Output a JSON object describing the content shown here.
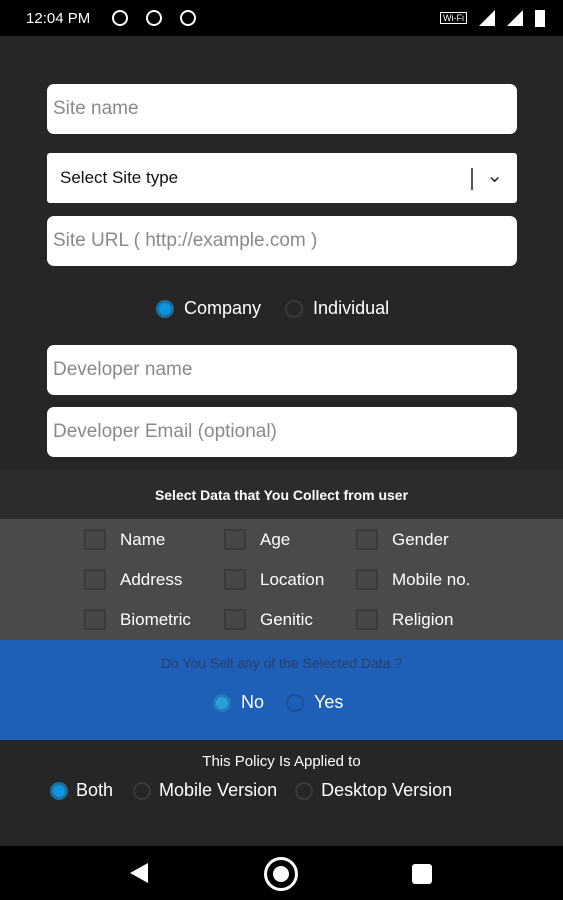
{
  "status_bar": {
    "time": "12:04 PM",
    "wifi_label": "Wi-Fi"
  },
  "form": {
    "site_name_placeholder": "Site name",
    "site_type_selected": "Select Site type",
    "site_url_placeholder": "Site URL ( http://example.com )",
    "owner_type": {
      "options": [
        "Company",
        "Individual"
      ],
      "selected": "Company"
    },
    "developer_name_placeholder": "Developer name",
    "developer_email_placeholder": "Developer Email (optional)"
  },
  "data_collection": {
    "heading": "Select Data that You Collect from user",
    "items": [
      "Name",
      "Age",
      "Gender",
      "Address",
      "Location",
      "Mobile no.",
      "Biometric",
      "Genitic",
      "Religion"
    ]
  },
  "sell_data": {
    "question": "Do You Sell any of the Selected Data ?",
    "options": [
      "No",
      "Yes"
    ],
    "selected": "No"
  },
  "policy_scope": {
    "heading": "This Policy Is Applied to",
    "options": [
      "Both",
      "Mobile Version",
      "Desktop Version"
    ],
    "selected": "Both"
  },
  "colors": {
    "background": "#262626",
    "accent": "#0c95e0",
    "sell_panel": "#1e5fb7"
  },
  "nav_bar": {
    "icons": [
      "back-icon",
      "home-icon",
      "recents-icon"
    ]
  }
}
